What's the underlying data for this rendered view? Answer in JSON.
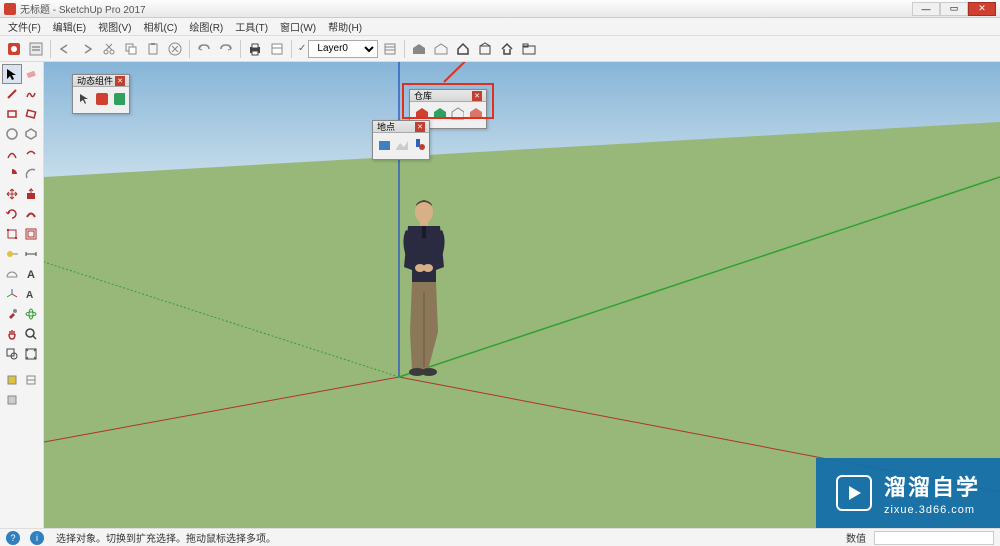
{
  "window": {
    "title": "无标题 - SketchUp Pro 2017",
    "controls": {
      "min": "—",
      "max": "▭",
      "close": "✕"
    }
  },
  "menu": {
    "items": [
      "文件(F)",
      "编辑(E)",
      "视图(V)",
      "相机(C)",
      "绘图(R)",
      "工具(T)",
      "窗口(W)",
      "帮助(H)"
    ]
  },
  "toolbar": {
    "layer_label": "Layer0"
  },
  "panels": {
    "dynamic": {
      "title": "动态组件"
    },
    "warehouse": {
      "title": "仓库"
    },
    "location": {
      "title": "地点"
    }
  },
  "statusbar": {
    "hint": "选择对象。切换到扩充选择。拖动鼠标选择多项。",
    "value_label": "数值"
  },
  "watermark": {
    "brand": "溜溜自学",
    "url": "zixue.3d66.com"
  },
  "colors": {
    "highlight": "#e03020",
    "sky": "#c5e0ef",
    "ground": "#9fc088",
    "axis_red": "#b03030",
    "axis_green": "#30a030",
    "axis_blue": "#3060c0"
  }
}
